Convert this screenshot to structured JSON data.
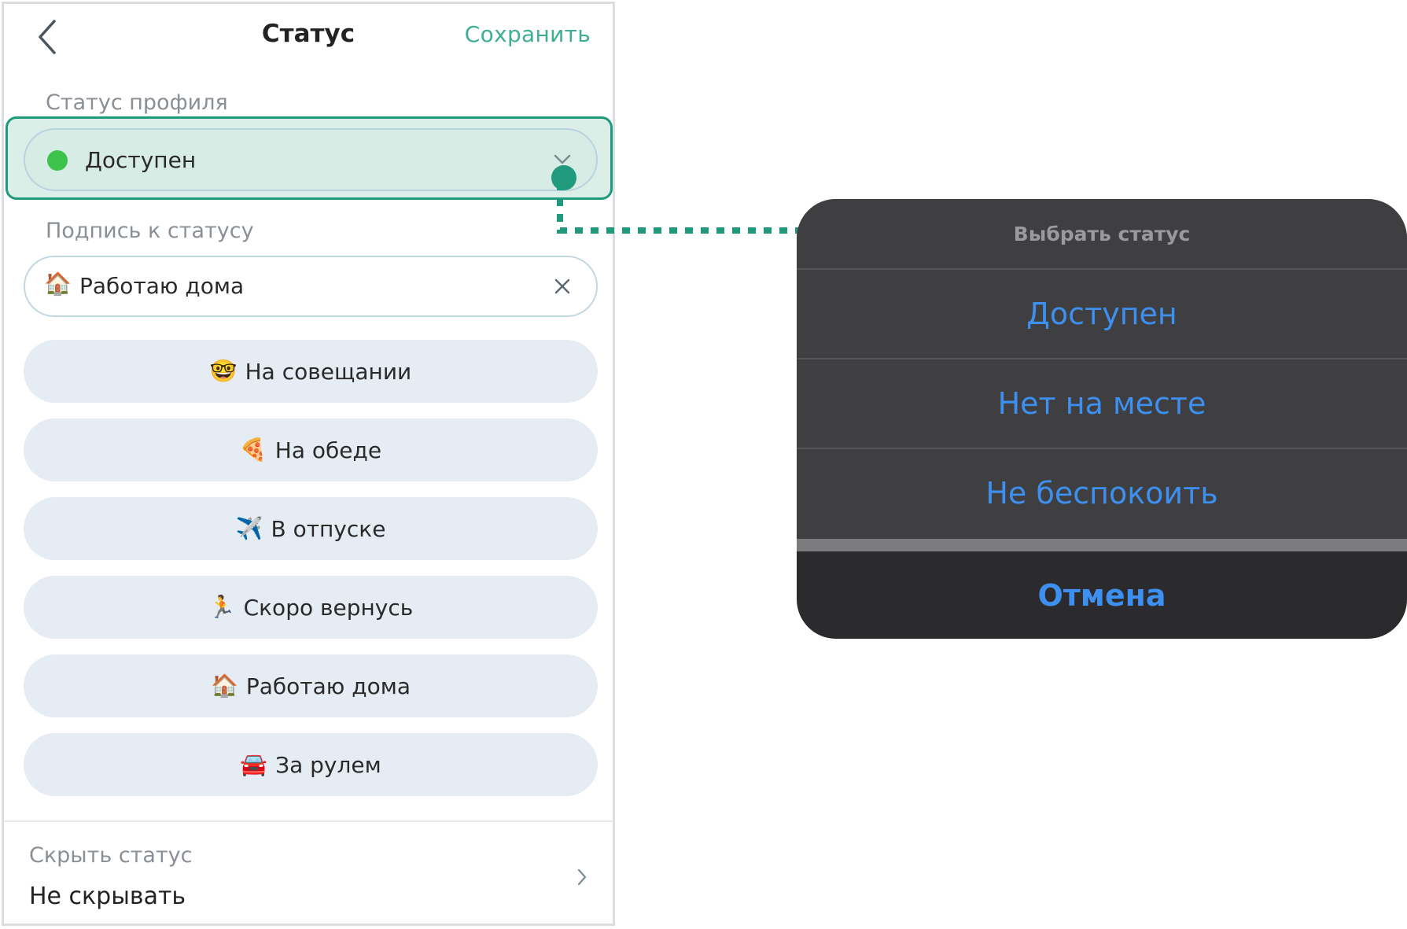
{
  "header": {
    "title": "Статус",
    "save_label": "Сохранить"
  },
  "profile_status": {
    "label": "Статус профиля",
    "value": "Доступен",
    "dot_color": "#3dc24b"
  },
  "caption": {
    "label": "Подпись к статусу",
    "emoji": "🏠",
    "value": "Работаю дома"
  },
  "presets": [
    {
      "emoji": "🤓",
      "label": "На совещании"
    },
    {
      "emoji": "🍕",
      "label": "На обеде"
    },
    {
      "emoji": "✈️",
      "label": "В отпуске"
    },
    {
      "emoji": "🏃",
      "label": "Скоро вернусь"
    },
    {
      "emoji": "🏠",
      "label": "Работаю дома"
    },
    {
      "emoji": "🚘",
      "label": "За рулем"
    }
  ],
  "hide_status": {
    "label": "Скрыть статус",
    "value": "Не скрывать"
  },
  "action_sheet": {
    "title": "Выбрать статус",
    "options": [
      "Доступен",
      "Нет на месте",
      "Не беспокоить"
    ],
    "cancel": "Отмена"
  },
  "colors": {
    "accent": "#3fae95",
    "highlight": "#1f9a7c",
    "sheet_option": "#3d8ff0"
  }
}
